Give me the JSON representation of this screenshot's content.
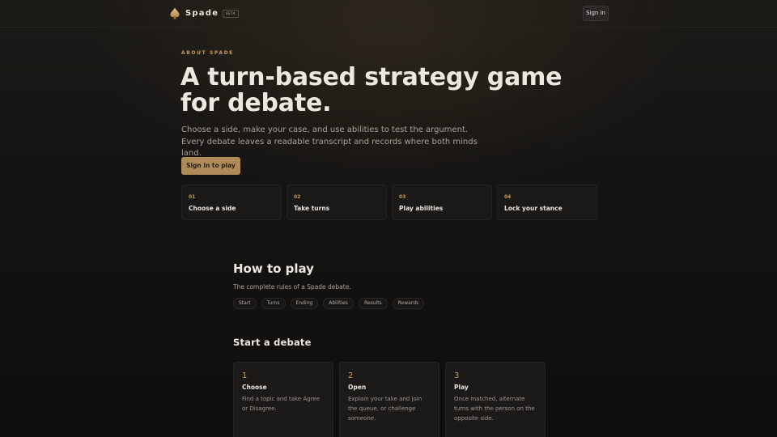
{
  "header": {
    "brand_name": "Spade",
    "beta_badge": "BETA",
    "signin_label": "Sign in"
  },
  "hero": {
    "eyebrow": "ABOUT SPADE",
    "title": "A turn-based strategy game for debate.",
    "description": "Choose a side, make your case, and use abilities to test the argument. Every debate leaves a readable transcript and records where both minds land.",
    "cta_label": "Sign in to play"
  },
  "steps": [
    {
      "num": "01",
      "title": "Choose a side"
    },
    {
      "num": "02",
      "title": "Take turns"
    },
    {
      "num": "03",
      "title": "Play abilities"
    },
    {
      "num": "04",
      "title": "Lock your stance"
    }
  ],
  "how_to_play": {
    "title": "How to play",
    "subtitle": "The complete rules of a Spade debate.",
    "chips": [
      "Start",
      "Turns",
      "Ending",
      "Abilities",
      "Results",
      "Rewards"
    ]
  },
  "start_section": {
    "title": "Start a debate",
    "cards": [
      {
        "num": "1",
        "title": "Choose",
        "desc": "Find a topic and take Agree or Disagree."
      },
      {
        "num": "2",
        "title": "Open",
        "desc": "Explain your take and join the queue, or challenge someone."
      },
      {
        "num": "3",
        "title": "Play",
        "desc": "Once matched, alternate turns with the person on the opposite side."
      }
    ]
  },
  "colors": {
    "accent": "#c79a5e",
    "button": "#b08b5a",
    "background": "#141312"
  },
  "icons": {
    "brand": "spade-icon"
  }
}
